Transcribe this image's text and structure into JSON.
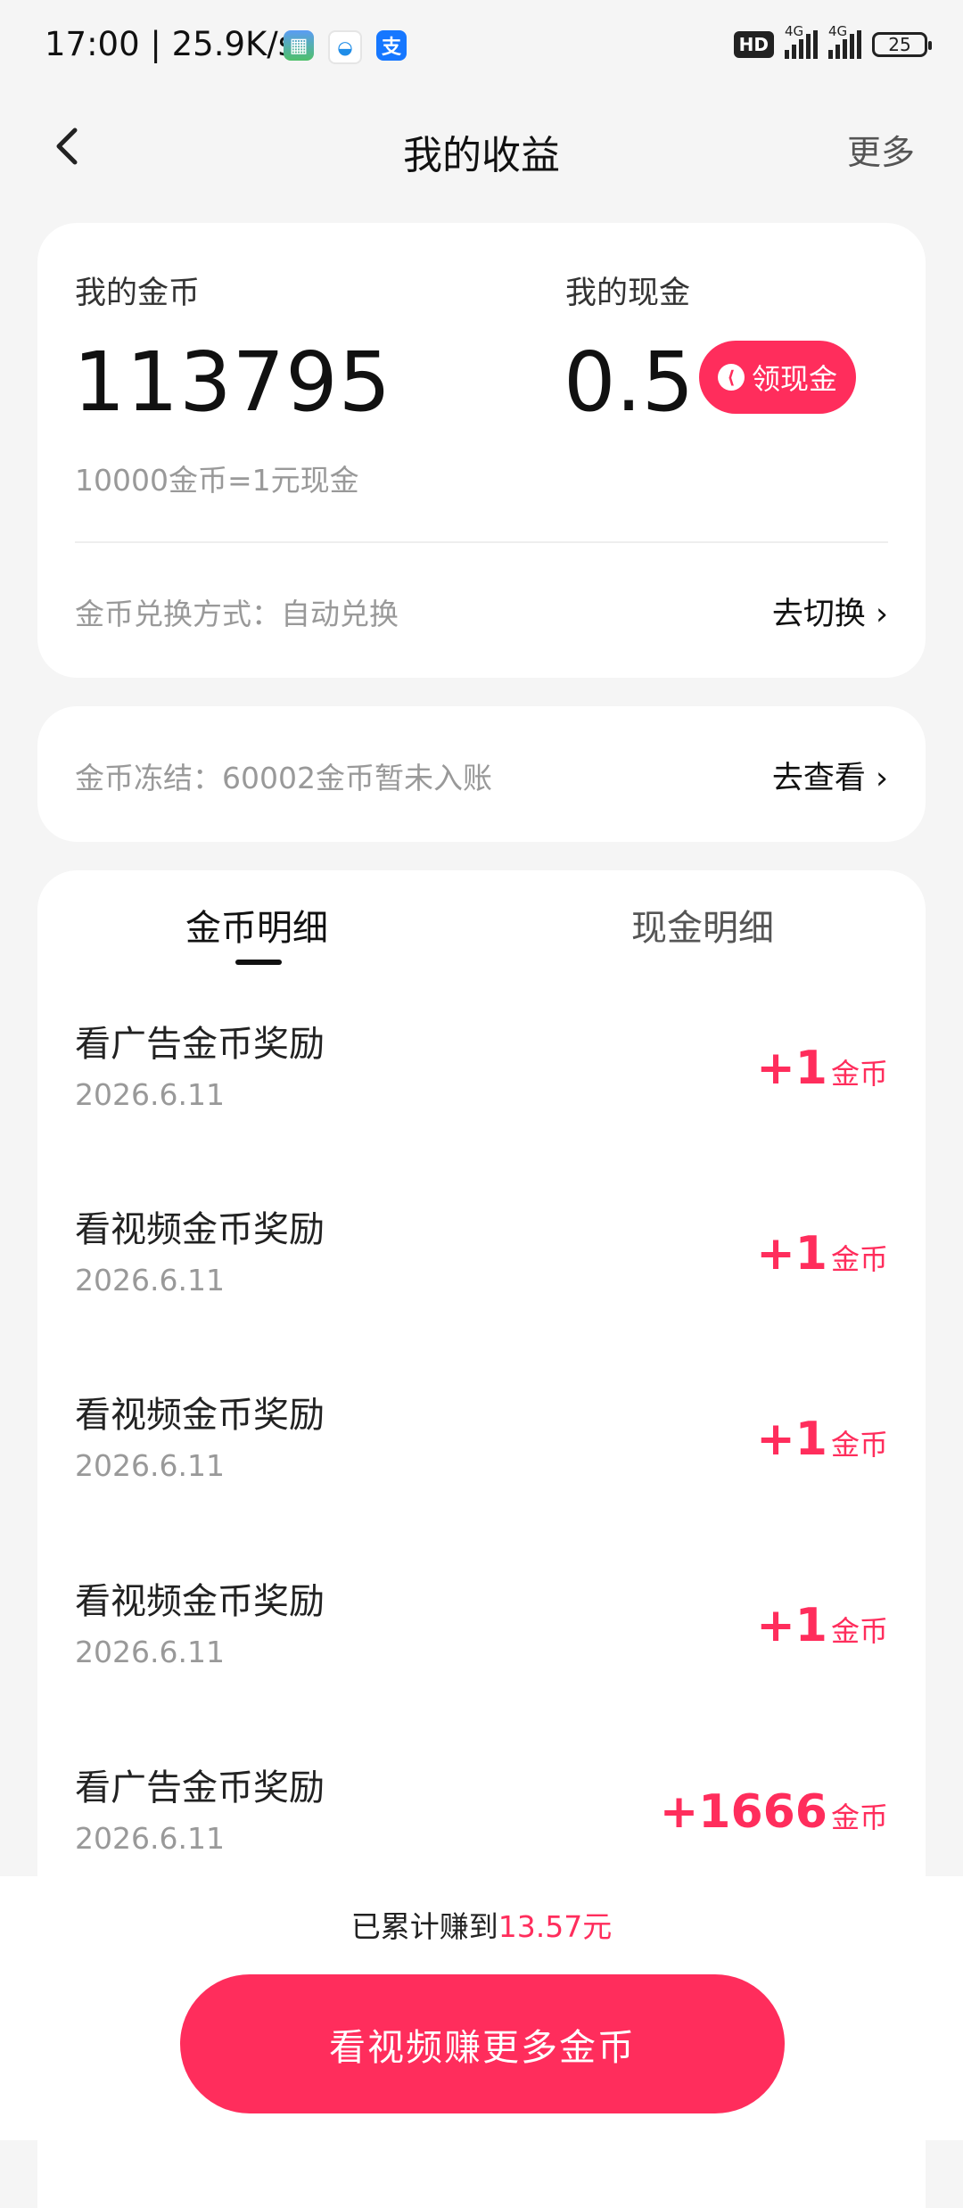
{
  "status_bar": {
    "time": "17:00",
    "network_speed": "25.9K/s",
    "separator": "|",
    "hd_label": "HD",
    "signal1_label": "4G",
    "signal2_label": "4G",
    "battery": "25",
    "app3_glyph": "支"
  },
  "nav": {
    "back_icon": "back-chevron-icon",
    "title": "我的收益",
    "more": "更多"
  },
  "balance": {
    "coins_label": "我的金币",
    "coins_value": "113795",
    "cash_label": "我的现金",
    "cash_value": "0.5",
    "withdraw_label": "领现金",
    "rate_text": "10000金币=1元现金",
    "mode_text": "金币兑换方式：自动兑换",
    "mode_link": "去切换"
  },
  "frozen": {
    "text": "金币冻结：60002金币暂未入账",
    "link": "去查看"
  },
  "tabs": {
    "coins": "金币明细",
    "cash": "现金明细"
  },
  "records": [
    {
      "title": "看广告金币奖励",
      "date": "2026.6.11",
      "amount": "+1",
      "unit": "金币"
    },
    {
      "title": "看视频金币奖励",
      "date": "2026.6.11",
      "amount": "+1",
      "unit": "金币"
    },
    {
      "title": "看视频金币奖励",
      "date": "2026.6.11",
      "amount": "+1",
      "unit": "金币"
    },
    {
      "title": "看视频金币奖励",
      "date": "2026.6.11",
      "amount": "+1",
      "unit": "金币"
    },
    {
      "title": "看广告金币奖励",
      "date": "2026.6.11",
      "amount": "+1666",
      "unit": "金币"
    }
  ],
  "bottom": {
    "earned_prefix": "已累计赚到",
    "earned_amount": "13.57元",
    "cta": "看视频赚更多金币"
  },
  "colors": {
    "accent": "#ff2d5c",
    "background": "#f5f5f5"
  }
}
